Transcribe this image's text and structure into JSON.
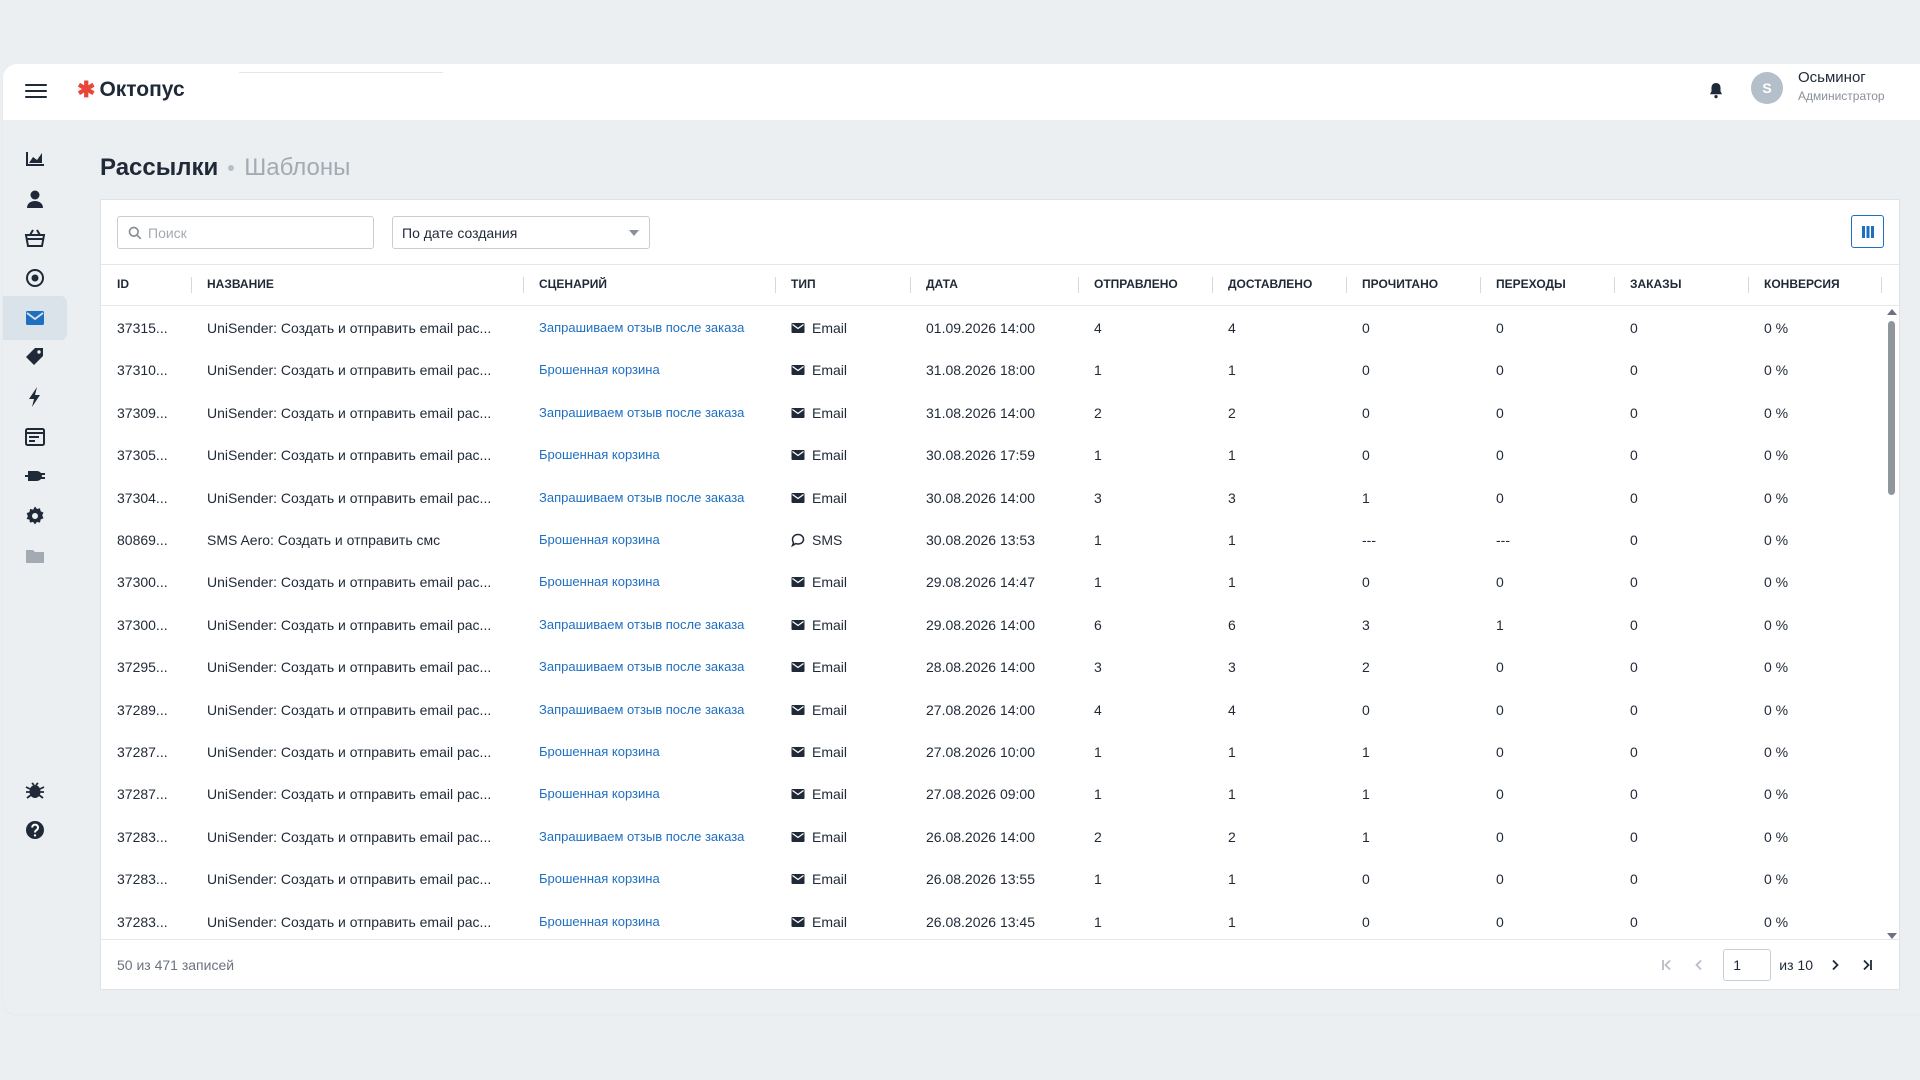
{
  "app": {
    "logo": "Октопус"
  },
  "user": {
    "name": "Осьминог",
    "role": "Администратор",
    "avatar_initial": "S"
  },
  "sidebar": {
    "items": [
      {
        "icon": "chart-area-icon",
        "active": false
      },
      {
        "icon": "user-icon",
        "active": false
      },
      {
        "icon": "basket-icon",
        "active": false
      },
      {
        "icon": "target-icon",
        "active": false
      },
      {
        "icon": "envelope-icon",
        "active": true
      },
      {
        "icon": "tag-icon",
        "active": false
      },
      {
        "icon": "bolt-icon",
        "active": false
      },
      {
        "icon": "window-icon",
        "active": false
      },
      {
        "icon": "plug-icon",
        "active": false
      },
      {
        "icon": "gear-icon",
        "active": false
      },
      {
        "icon": "folder-icon",
        "active": false
      }
    ],
    "bottom": [
      {
        "icon": "bug-icon"
      },
      {
        "icon": "help-icon"
      }
    ]
  },
  "page": {
    "title": "Рассылки",
    "subtitle": "Шаблоны"
  },
  "filters": {
    "search_placeholder": "Поиск",
    "sort_value": "По дате создания"
  },
  "table": {
    "columns": [
      "ID",
      "НАЗВАНИЕ",
      "СЦЕНАРИЙ",
      "ТИП",
      "ДАТА",
      "ОТПРАВЛЕНО",
      "ДОСТАВЛЕНО",
      "ПРОЧИТАНО",
      "ПЕРЕХОДЫ",
      "ЗАКАЗЫ",
      "КОНВЕРСИЯ"
    ],
    "rows": [
      {
        "id": "37315...",
        "name": "UniSender: Создать и отправить email рас...",
        "scenario": "Запрашиваем отзыв после заказа",
        "type": "Email",
        "date": "01.09.2026 14:00",
        "sent": "4",
        "delivered": "4",
        "read": "0",
        "clicks": "0",
        "orders": "0",
        "conversion": "0 %"
      },
      {
        "id": "37310...",
        "name": "UniSender: Создать и отправить email рас...",
        "scenario": "Брошенная корзина",
        "type": "Email",
        "date": "31.08.2026 18:00",
        "sent": "1",
        "delivered": "1",
        "read": "0",
        "clicks": "0",
        "orders": "0",
        "conversion": "0 %"
      },
      {
        "id": "37309...",
        "name": "UniSender: Создать и отправить email рас...",
        "scenario": "Запрашиваем отзыв после заказа",
        "type": "Email",
        "date": "31.08.2026 14:00",
        "sent": "2",
        "delivered": "2",
        "read": "0",
        "clicks": "0",
        "orders": "0",
        "conversion": "0 %"
      },
      {
        "id": "37305...",
        "name": "UniSender: Создать и отправить email рас...",
        "scenario": "Брошенная корзина",
        "type": "Email",
        "date": "30.08.2026 17:59",
        "sent": "1",
        "delivered": "1",
        "read": "0",
        "clicks": "0",
        "orders": "0",
        "conversion": "0 %"
      },
      {
        "id": "37304...",
        "name": "UniSender: Создать и отправить email рас...",
        "scenario": "Запрашиваем отзыв после заказа",
        "type": "Email",
        "date": "30.08.2026 14:00",
        "sent": "3",
        "delivered": "3",
        "read": "1",
        "clicks": "0",
        "orders": "0",
        "conversion": "0 %"
      },
      {
        "id": "80869...",
        "name": "SMS Aero: Создать и отправить смс",
        "scenario": "Брошенная корзина",
        "type": "SMS",
        "date": "30.08.2026 13:53",
        "sent": "1",
        "delivered": "1",
        "read": "---",
        "clicks": "---",
        "orders": "0",
        "conversion": "0 %"
      },
      {
        "id": "37300...",
        "name": "UniSender: Создать и отправить email рас...",
        "scenario": "Брошенная корзина",
        "type": "Email",
        "date": "29.08.2026 14:47",
        "sent": "1",
        "delivered": "1",
        "read": "0",
        "clicks": "0",
        "orders": "0",
        "conversion": "0 %"
      },
      {
        "id": "37300...",
        "name": "UniSender: Создать и отправить email рас...",
        "scenario": "Запрашиваем отзыв после заказа",
        "type": "Email",
        "date": "29.08.2026 14:00",
        "sent": "6",
        "delivered": "6",
        "read": "3",
        "clicks": "1",
        "orders": "0",
        "conversion": "0 %"
      },
      {
        "id": "37295...",
        "name": "UniSender: Создать и отправить email рас...",
        "scenario": "Запрашиваем отзыв после заказа",
        "type": "Email",
        "date": "28.08.2026 14:00",
        "sent": "3",
        "delivered": "3",
        "read": "2",
        "clicks": "0",
        "orders": "0",
        "conversion": "0 %"
      },
      {
        "id": "37289...",
        "name": "UniSender: Создать и отправить email рас...",
        "scenario": "Запрашиваем отзыв после заказа",
        "type": "Email",
        "date": "27.08.2026 14:00",
        "sent": "4",
        "delivered": "4",
        "read": "0",
        "clicks": "0",
        "orders": "0",
        "conversion": "0 %"
      },
      {
        "id": "37287...",
        "name": "UniSender: Создать и отправить email рас...",
        "scenario": "Брошенная корзина",
        "type": "Email",
        "date": "27.08.2026 10:00",
        "sent": "1",
        "delivered": "1",
        "read": "1",
        "clicks": "0",
        "orders": "0",
        "conversion": "0 %"
      },
      {
        "id": "37287...",
        "name": "UniSender: Создать и отправить email рас...",
        "scenario": "Брошенная корзина",
        "type": "Email",
        "date": "27.08.2026 09:00",
        "sent": "1",
        "delivered": "1",
        "read": "1",
        "clicks": "0",
        "orders": "0",
        "conversion": "0 %"
      },
      {
        "id": "37283...",
        "name": "UniSender: Создать и отправить email рас...",
        "scenario": "Запрашиваем отзыв после заказа",
        "type": "Email",
        "date": "26.08.2026 14:00",
        "sent": "2",
        "delivered": "2",
        "read": "1",
        "clicks": "0",
        "orders": "0",
        "conversion": "0 %"
      },
      {
        "id": "37283...",
        "name": "UniSender: Создать и отправить email рас...",
        "scenario": "Брошенная корзина",
        "type": "Email",
        "date": "26.08.2026 13:55",
        "sent": "1",
        "delivered": "1",
        "read": "0",
        "clicks": "0",
        "orders": "0",
        "conversion": "0 %"
      },
      {
        "id": "37283...",
        "name": "UniSender: Создать и отправить email рас...",
        "scenario": "Брошенная корзина",
        "type": "Email",
        "date": "26.08.2026 13:45",
        "sent": "1",
        "delivered": "1",
        "read": "0",
        "clicks": "0",
        "orders": "0",
        "conversion": "0 %"
      }
    ]
  },
  "footer": {
    "count_text": "50 из 471 записей",
    "page_value": "1",
    "page_total": "из 10"
  },
  "colors": {
    "accent": "#1f6fc1",
    "logo_star": "#e8463a",
    "text": "#1f2937",
    "muted": "#a3aab2"
  }
}
